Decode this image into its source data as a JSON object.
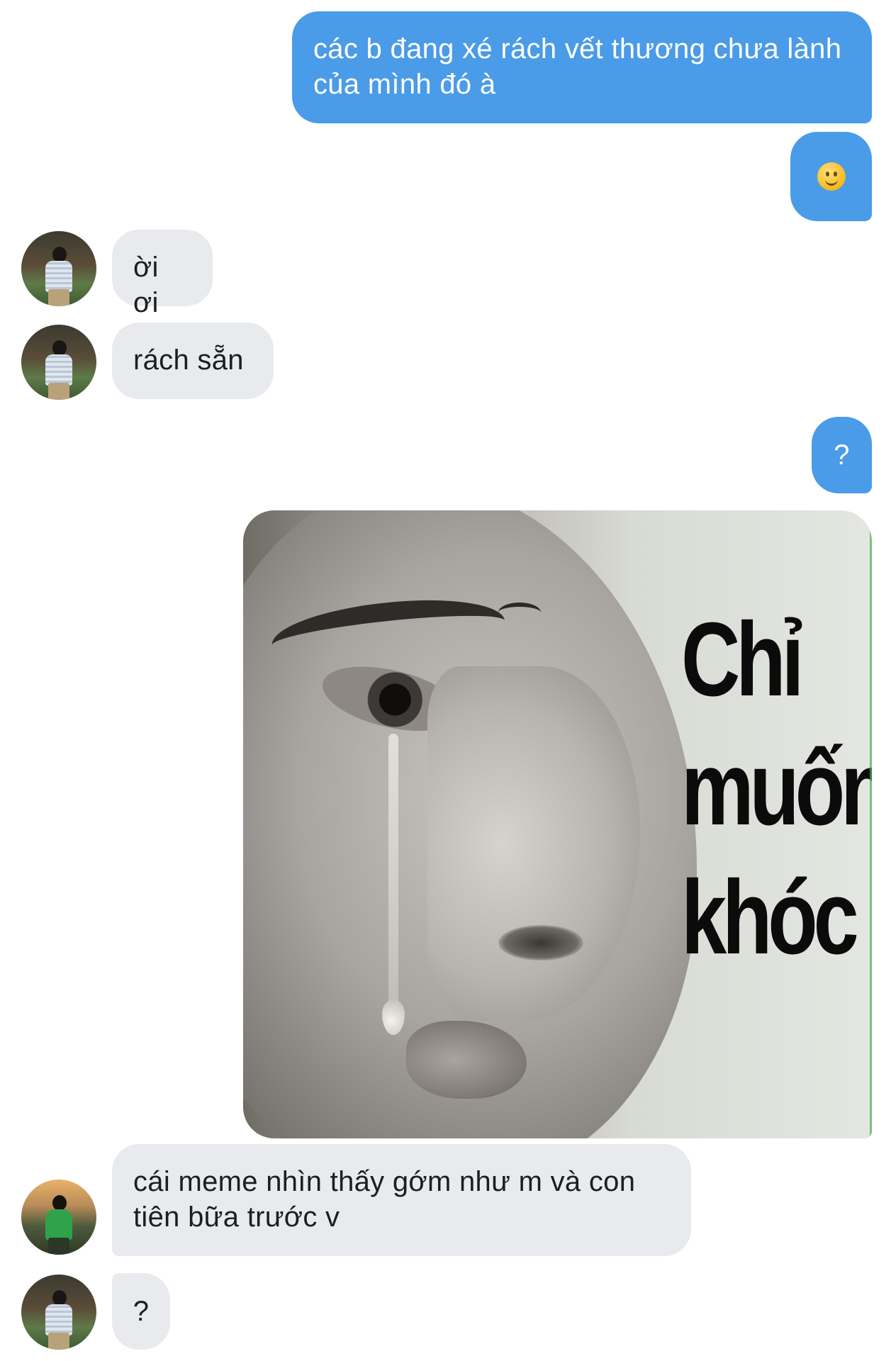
{
  "messages": {
    "m1": "các b đang xé rách vết thương chưa lành của mình đó à",
    "m3": "ời ơi",
    "m4": "rách sẵn",
    "m5": "?",
    "m7": "cái meme nhìn thấy gớm như m và con tiên bữa trước v",
    "m8": "?"
  },
  "meme": {
    "caption_lines": [
      "Chỉ",
      "muốn",
      "khóc"
    ]
  },
  "icons": {
    "emoji": "slightly-smiling-face-icon"
  },
  "colors": {
    "outgoing_bubble": "#4a9be8",
    "incoming_bubble": "#e9eaee"
  }
}
